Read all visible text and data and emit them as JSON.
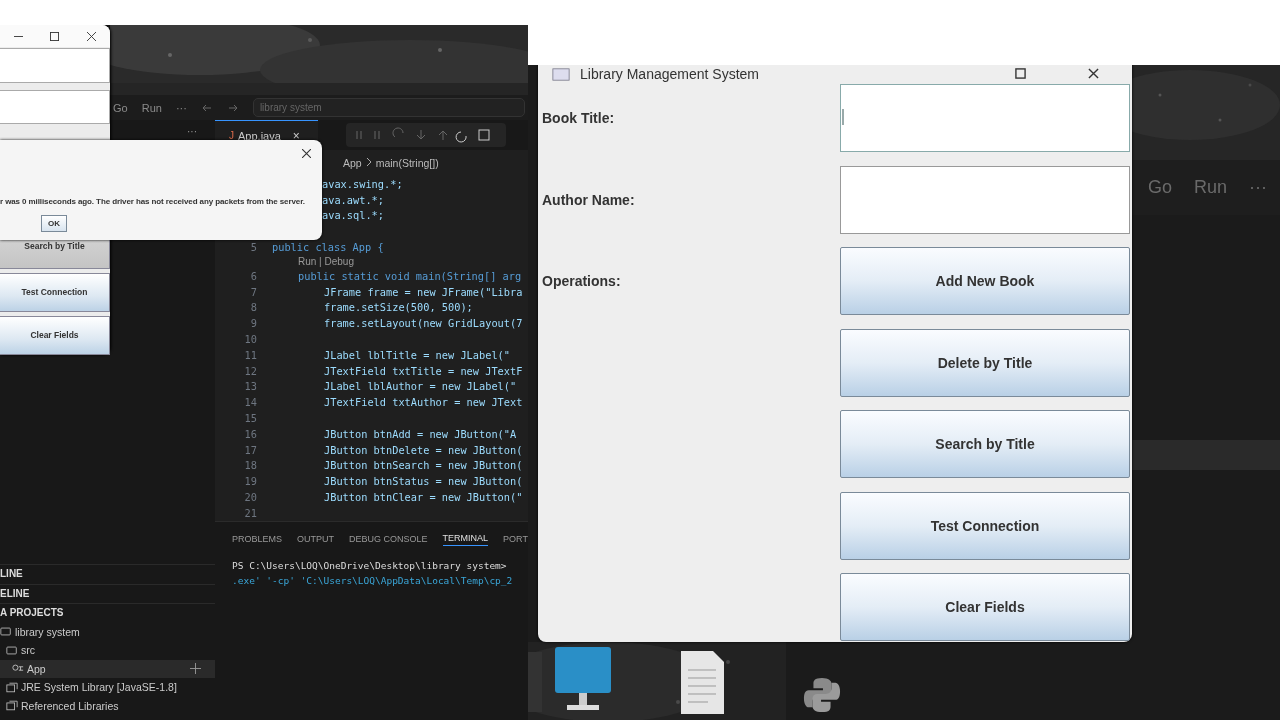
{
  "ide": {
    "menu": [
      "Go",
      "Run",
      "···"
    ],
    "search": "library system",
    "sidebar_more": "···",
    "sections": [
      "LINE",
      "ELINE",
      "A PROJECTS"
    ],
    "projects": [
      {
        "label": "library system",
        "kind": "folder",
        "selected": false,
        "children": [
          {
            "label": "src",
            "kind": "folder",
            "selected": false,
            "children": [
              {
                "label": "App",
                "kind": "class",
                "selected": true
              }
            ]
          },
          {
            "label": "JRE System Library [JavaSE-1.8]",
            "kind": "library",
            "selected": false
          },
          {
            "label": "Referenced Libraries",
            "kind": "library",
            "selected": false
          }
        ]
      }
    ],
    "editor": {
      "tab_icon": "J",
      "tab": "App.java",
      "tab_close": "×",
      "breadcrumb": [
        "App",
        "main(String[])"
      ],
      "lines": [
        {
          "kind": "clipped",
          "code": "avax.swing.*;"
        },
        {
          "kind": "clipped",
          "code": "ava.awt.*;"
        },
        {
          "kind": "clipped",
          "code": "ava.sql.*;"
        },
        {
          "kind": "blank"
        },
        {
          "kind": "class",
          "number": "5",
          "code": "public class App {"
        },
        {
          "kind": "lens",
          "code": "Run | Debug"
        },
        {
          "kind": "method",
          "number": "6",
          "code": "public static void main(String[] arg"
        },
        {
          "kind": "body",
          "number": "7",
          "code": "JFrame frame = new JFrame(\"Libra"
        },
        {
          "kind": "body",
          "number": "8",
          "code": "frame.setSize(500, 500);"
        },
        {
          "kind": "body",
          "number": "9",
          "code": "frame.setLayout(new GridLayout(7"
        },
        {
          "kind": "body",
          "number": "10"
        },
        {
          "kind": "body",
          "number": "11",
          "code": "JLabel lblTitle = new JLabel(\""
        },
        {
          "kind": "body",
          "number": "12",
          "code": "JTextField txtTitle = new JTextF"
        },
        {
          "kind": "body",
          "number": "13",
          "code": "JLabel lblAuthor = new JLabel(\""
        },
        {
          "kind": "body",
          "number": "14",
          "code": "JTextField txtAuthor = new JText"
        },
        {
          "kind": "body",
          "number": "15"
        },
        {
          "kind": "body",
          "number": "16",
          "code": "JButton btnAdd = new JButton(\"A"
        },
        {
          "kind": "body",
          "number": "17",
          "code": "JButton btnDelete = new JButton("
        },
        {
          "kind": "body",
          "number": "18",
          "code": "JButton btnSearch = new JButton("
        },
        {
          "kind": "body",
          "number": "19",
          "code": "JButton btnStatus = new JButton("
        },
        {
          "kind": "body",
          "number": "20",
          "code": "JButton btnClear = new JButton(\""
        },
        {
          "kind": "body",
          "number": "21"
        }
      ]
    },
    "panel": {
      "tabs": [
        {
          "label": "PROBLEMS",
          "selected": false
        },
        {
          "label": "OUTPUT",
          "selected": false
        },
        {
          "label": "DEBUG CONSOLE",
          "selected": false
        },
        {
          "label": "TERMINAL",
          "selected": true
        },
        {
          "label": "PORT",
          "selected": false
        }
      ],
      "terminal": [
        {
          "kind": "prompt",
          "text": "PS C:\\Users\\LOQ\\OneDrive\\Desktop\\library system>"
        },
        {
          "kind": "command",
          "text": ".exe' '-cp' 'C:\\Users\\LOQ\\AppData\\Local\\Temp\\cp_2"
        }
      ]
    }
  },
  "small_window": {
    "buttons": [
      {
        "label": "Search by Title",
        "pressed": true
      },
      {
        "label": "Test Connection",
        "pressed": false
      },
      {
        "label": "Clear Fields",
        "pressed": false
      }
    ]
  },
  "dialog": {
    "message": "r was 0 milliseconds ago. The driver has not received any packets from the server.",
    "button": "OK"
  },
  "app_window": {
    "title": "Library Management System",
    "fields": [
      {
        "label": "Book Title:",
        "focused": true
      },
      {
        "label": "Author Name:",
        "focused": false
      }
    ],
    "operations_label": "Operations:",
    "buttons": [
      "Add New Book",
      "Delete by Title",
      "Search by Title",
      "Test Connection",
      "Clear Fields"
    ]
  },
  "background_ide": {
    "menu": [
      "Go",
      "Run",
      "···"
    ]
  }
}
